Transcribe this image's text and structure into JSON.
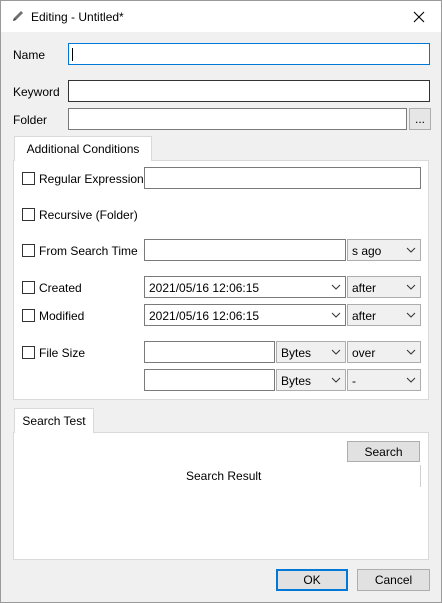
{
  "window": {
    "title": "Editing - Untitled*",
    "icon": "pencil-icon",
    "close": "close-icon"
  },
  "form": {
    "name_label": "Name",
    "name_value": "",
    "keyword_label": "Keyword",
    "keyword_value": "",
    "folder_label": "Folder",
    "folder_value": "",
    "browse_label": "..."
  },
  "conditions": {
    "tab_label": "Additional Conditions",
    "regex_label": "Regular Expression",
    "regex_value": "",
    "recursive_label": "Recursive (Folder)",
    "from_search_label": "From Search Time",
    "from_search_value": "",
    "from_search_unit": "s ago",
    "created_label": "Created",
    "created_date": "2021/05/16 12:06:15",
    "created_cmp": "after",
    "modified_label": "Modified",
    "modified_date": "2021/05/16 12:06:15",
    "modified_cmp": "after",
    "filesize_label": "File Size",
    "size1_value": "",
    "size1_unit": "Bytes",
    "size1_cmp": "over",
    "size2_value": "",
    "size2_unit": "Bytes",
    "size2_cmp": "-"
  },
  "search_test": {
    "tab_label": "Search Test",
    "search_button": "Search",
    "result_label": "Search Result"
  },
  "footer": {
    "ok_label": "OK",
    "cancel_label": "Cancel"
  },
  "colors": {
    "focus": "#0078d7",
    "window_bg": "#f0f0f0",
    "panel_bg": "#ffffff"
  }
}
